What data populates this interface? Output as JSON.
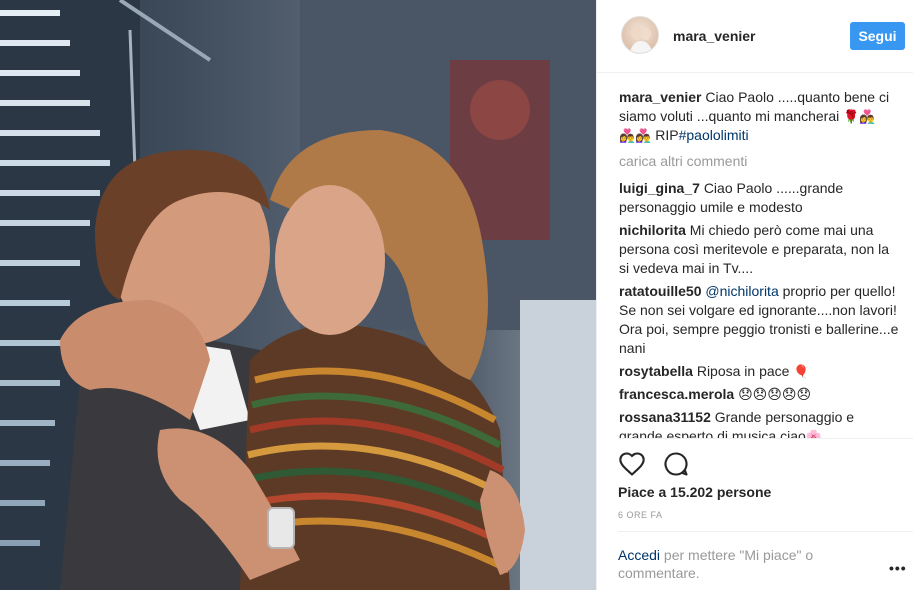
{
  "post": {
    "username": "mara_venier",
    "follow_label": "Segui"
  },
  "caption": {
    "username": "mara_venier",
    "text": "Ciao Paolo .....quanto bene ci siamo voluti ...quanto mi mancherai ",
    "rip": " RIP",
    "hashtag": "#paololimiti"
  },
  "load_more_label": "carica altri commenti",
  "comments": [
    {
      "username": "luigi_gina_7",
      "text": "Ciao Paolo ......grande personaggio umile e modesto"
    },
    {
      "username": "nichilorita",
      "text": "Mi chiedo però come mai una persona così meritevole e preparata, non la si vedeva mai in Tv...."
    },
    {
      "username": "ratatouille50",
      "mention": "@nichilorita",
      "text": " proprio per quello! Se non sei volgare ed ignorante....non lavori! Ora poi, sempre peggio tronisti e ballerine...e nani"
    },
    {
      "username": "rosytabella",
      "text": "Riposa in pace "
    },
    {
      "username": "francesca.merola",
      "text": "😞😞😞😞😞"
    },
    {
      "username": "rossana31152",
      "text": "Grande personaggio e grande esperto di musica ciao"
    }
  ],
  "likes_text": "Piace a 15.202 persone",
  "time_ago": "6 ORE FA",
  "login": {
    "link_label": "Accedi",
    "rest_text": " per mettere \"Mi piace\" o commentare."
  },
  "more_label": "•••",
  "icons": {
    "like": "heart-icon",
    "comment": "comment-icon",
    "rose": "rose-icon",
    "balloon": "balloon-icon",
    "flower": "flower-icon",
    "couple": "couple-icon"
  },
  "colors": {
    "follow_bg": "#3897f0",
    "link": "#003569",
    "muted": "#999999",
    "text": "#262626"
  }
}
